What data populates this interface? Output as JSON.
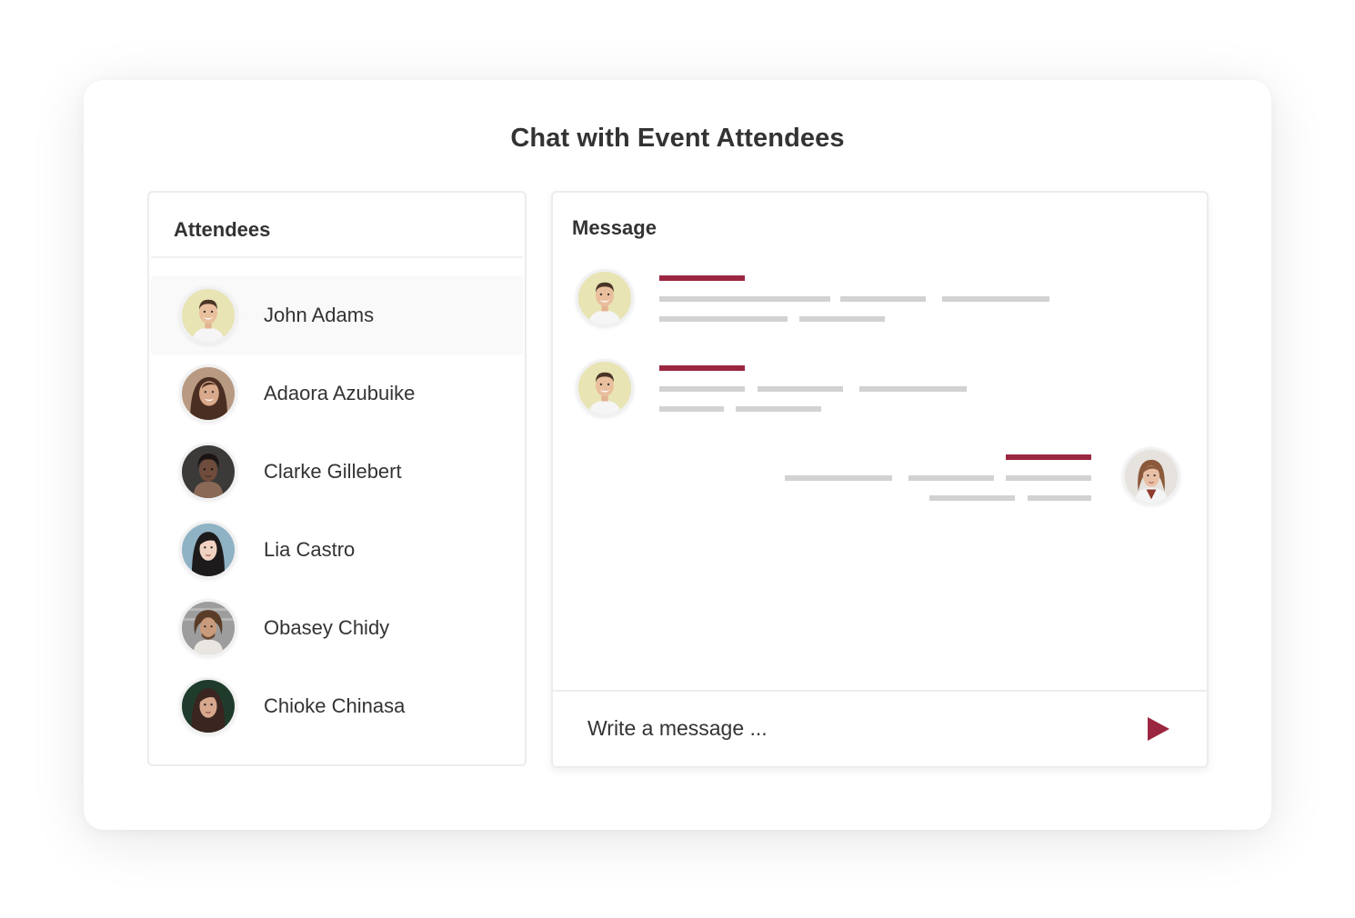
{
  "page": {
    "title": "Chat with Event Attendees",
    "accent_color": "#9b2640"
  },
  "attendees": {
    "title": "Attendees",
    "items": [
      {
        "name": "John Adams",
        "active": true,
        "avatar": "man-smiling-avatar"
      },
      {
        "name": "Adaora Azubuike",
        "active": false,
        "avatar": "woman-smiling-avatar"
      },
      {
        "name": "Clarke Gillebert",
        "active": false,
        "avatar": "woman-portrait-avatar"
      },
      {
        "name": "Lia Castro",
        "active": false,
        "avatar": "woman-dark-hair-avatar"
      },
      {
        "name": "Obasey Chidy",
        "active": false,
        "avatar": "man-curly-hair-avatar"
      },
      {
        "name": "Chioke Chinasa",
        "active": false,
        "avatar": "woman-long-hair-avatar"
      }
    ]
  },
  "messages": {
    "title": "Message",
    "thread": [
      {
        "sender": "John Adams",
        "side": "left"
      },
      {
        "sender": "John Adams",
        "side": "left"
      },
      {
        "sender": "self",
        "side": "right"
      }
    ]
  },
  "composer": {
    "placeholder": "Write a message ...",
    "send_icon": "send-triangle-icon"
  }
}
